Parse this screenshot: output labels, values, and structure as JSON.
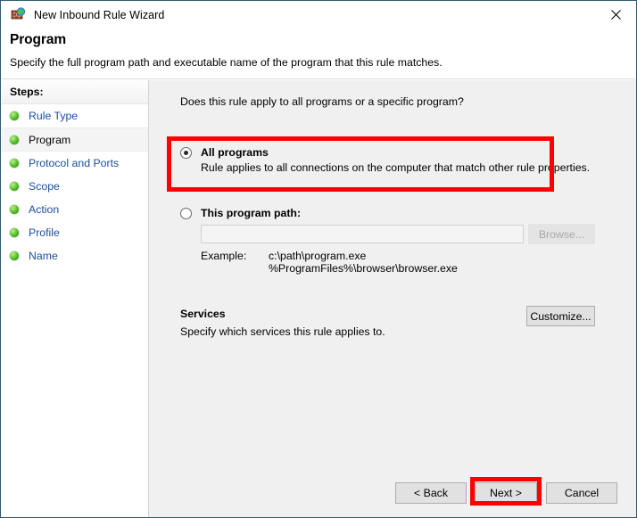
{
  "window": {
    "title": "New Inbound Rule Wizard",
    "title_icon": "firewall-globe-icon",
    "close_icon": "close-icon"
  },
  "header": {
    "title": "Program",
    "subtitle": "Specify the full program path and executable name of the program that this rule matches."
  },
  "sidebar": {
    "header": "Steps:",
    "items": [
      {
        "label": "Rule Type",
        "current": false
      },
      {
        "label": "Program",
        "current": true
      },
      {
        "label": "Protocol and Ports",
        "current": false
      },
      {
        "label": "Scope",
        "current": false
      },
      {
        "label": "Action",
        "current": false
      },
      {
        "label": "Profile",
        "current": false
      },
      {
        "label": "Name",
        "current": false
      }
    ]
  },
  "main": {
    "question": "Does this rule apply to all programs or a specific program?",
    "options": {
      "all_programs": {
        "label": "All programs",
        "description": "Rule applies to all connections on the computer that match other rule properties.",
        "selected": true
      },
      "this_program_path": {
        "label": "This program path:",
        "selected": false
      }
    },
    "path_field": {
      "value": "",
      "placeholder": ""
    },
    "browse_button": "Browse...",
    "example": {
      "label": "Example:",
      "line1": "c:\\path\\program.exe",
      "line2": "%ProgramFiles%\\browser\\browser.exe"
    },
    "services": {
      "title": "Services",
      "description": "Specify which services this rule applies to.",
      "customize_button": "Customize..."
    }
  },
  "footer": {
    "back_button": "< Back",
    "next_button": "Next >",
    "cancel_button": "Cancel"
  },
  "annotations": {
    "highlight_color": "#ff0000",
    "boxes": [
      {
        "name": "all-programs-option",
        "target": "All programs"
      },
      {
        "name": "next-button",
        "target": "Next >"
      }
    ]
  },
  "colors": {
    "window_border": "#2b5c75",
    "body_background": "#f0f0f0",
    "sidebar_background": "#ffffff",
    "link_text": "#1a4fa0",
    "step_bullet": "#2f9c15"
  }
}
